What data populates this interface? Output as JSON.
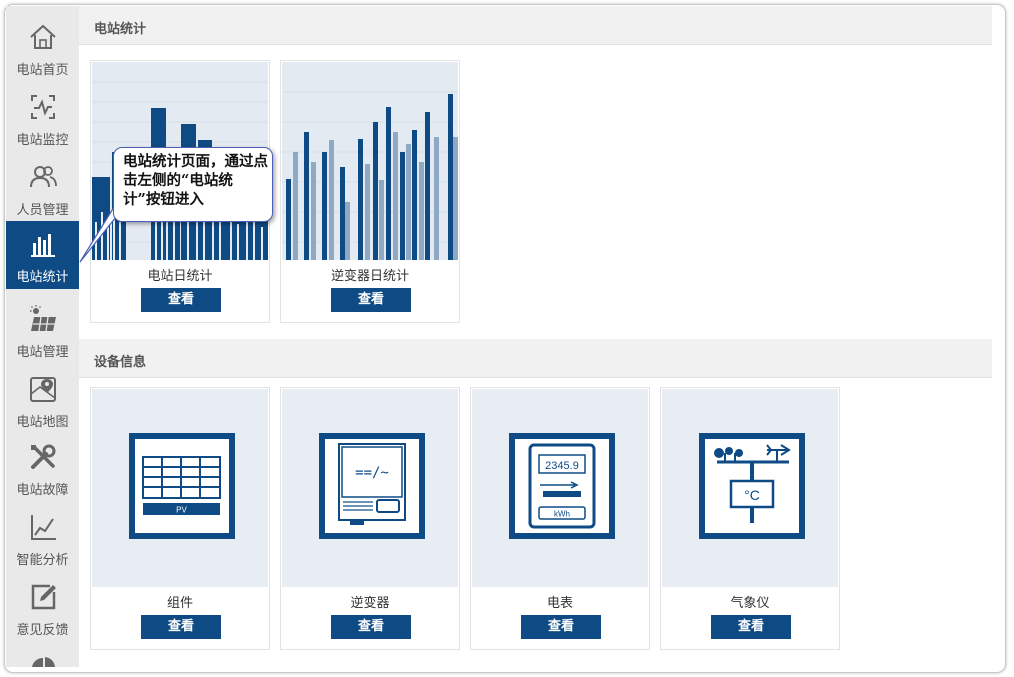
{
  "sidebar": {
    "items": [
      {
        "label": "电站首页",
        "icon": "home-icon"
      },
      {
        "label": "电站监控",
        "icon": "monitor-icon"
      },
      {
        "label": "人员管理",
        "icon": "people-icon"
      },
      {
        "label": "电站统计",
        "icon": "bar-chart-icon",
        "active": true
      },
      {
        "label": "电站管理",
        "icon": "solar-panel-icon"
      },
      {
        "label": "电站地图",
        "icon": "map-pin-icon"
      },
      {
        "label": "电站故障",
        "icon": "tools-icon"
      },
      {
        "label": "智能分析",
        "icon": "line-chart-icon"
      },
      {
        "label": "意见反馈",
        "icon": "edit-icon"
      }
    ]
  },
  "stats_section": {
    "title": "电站统计",
    "cards": [
      {
        "title": "电站日统计",
        "button": "查看"
      },
      {
        "title": "逆变器日统计",
        "button": "查看"
      }
    ]
  },
  "device_section": {
    "title": "设备信息",
    "cards": [
      {
        "title": "组件",
        "button": "查看",
        "icon": "pv-module-icon",
        "icon_text": "PV"
      },
      {
        "title": "逆变器",
        "button": "查看",
        "icon": "inverter-icon",
        "icon_text": "==/~"
      },
      {
        "title": "电表",
        "button": "查看",
        "icon": "meter-icon",
        "icon_text": "2345.9",
        "icon_unit": "kWh"
      },
      {
        "title": "气象仪",
        "button": "查看",
        "icon": "weather-station-icon",
        "icon_text": "°C"
      }
    ]
  },
  "tooltip": {
    "text": "电站统计页面，通过点击左侧的“电站统计”按钮进入"
  },
  "colors": {
    "primary": "#0e4b85",
    "sidebar_bg": "#e9e9e9",
    "thumb_bg": "#e8edf3",
    "light_bar": "#8fa9c4"
  }
}
